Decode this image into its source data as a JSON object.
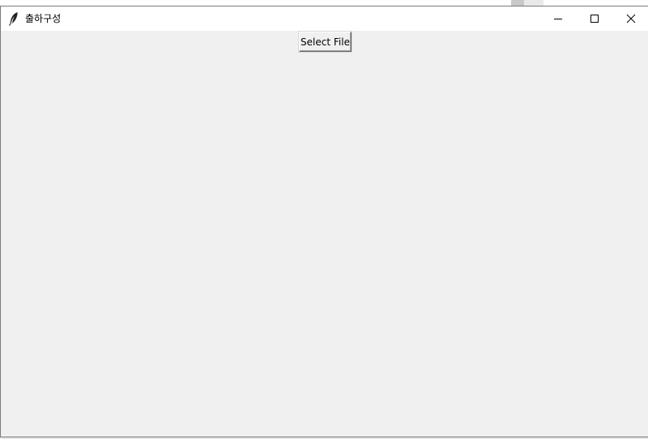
{
  "window": {
    "title": "출하구성",
    "icon": "feather-icon",
    "controls": {
      "minimize": "minimize-icon",
      "maximize": "maximize-icon",
      "close": "close-icon"
    }
  },
  "main": {
    "select_file_label": "Select File"
  },
  "colors": {
    "client_background": "#f0f0f0",
    "titlebar_background": "#ffffff"
  }
}
